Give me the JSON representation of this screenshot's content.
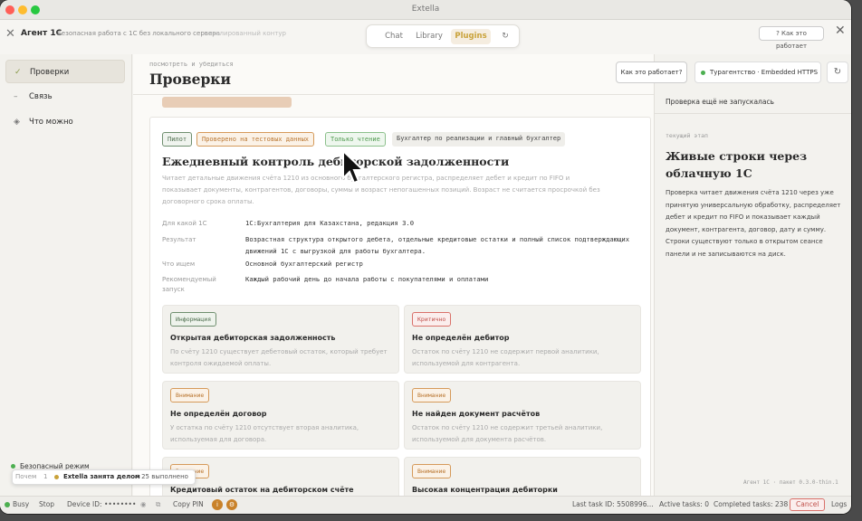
{
  "window": {
    "title": "Extella"
  },
  "header": {
    "brand": "Агент 1С",
    "subtitle": "Безопасная работа с 1С без локального сервера",
    "extra": "изолированный контур",
    "tabs": [
      {
        "label": "Chat"
      },
      {
        "label": "Library"
      },
      {
        "label": "Plugins",
        "active": true
      }
    ],
    "how_button": "? Как это работает"
  },
  "sidebar": {
    "items": [
      {
        "icon": "✓",
        "label": "Проверки",
        "active": true
      },
      {
        "icon": "–",
        "label": "Связь"
      },
      {
        "icon": "◈",
        "label": "Что можно"
      }
    ],
    "safe_mode": "Безопасный режим",
    "toast": {
      "prefix": "Почем",
      "num": "1",
      "busy": "Extella занята делом",
      "done": "✓ 25 выполнено"
    }
  },
  "main": {
    "breadcrumb": "посмотреть и убедиться",
    "title": "Проверки",
    "card": {
      "tags": [
        "Пилот",
        "Проверено на тестовых данных",
        "Только чтение",
        "Бухгалтер по реализации и главный бухгалтер"
      ],
      "title": "Ежедневный контроль дебиторской задолженности",
      "description": "Читает детальные движения счёта 1210 из основного бухгалтерского регистра, распределяет дебет и кредит по FIFO и показывает документы, контрагентов, договоры, суммы и возраст непогашенных позиций. Возраст не считается просрочкой без договорного срока оплаты.",
      "rows": [
        {
          "key": "Для какой 1С",
          "value": "1С:Бухгалтерия для Казахстана, редакция 3.0"
        },
        {
          "key": "Результат",
          "value": "Возрастная структура открытого дебета, отдельные кредитовые остатки и полный список подтверждающих движений 1С с выгрузкой для работы бухгалтера."
        },
        {
          "key": "Что ищем",
          "value": "Основной бухгалтерский регистр"
        },
        {
          "key": "Рекомендуемый запуск",
          "value": "Каждый рабочий день до начала работы с покупателями и оплатами"
        }
      ],
      "issues": [
        {
          "badge": "Информация",
          "level": "info",
          "title": "Открытая дебиторская задолженность",
          "desc": "По счёту 1210 существует дебетовый остаток, который требует контроля ожидаемой оплаты."
        },
        {
          "badge": "Критично",
          "level": "crit",
          "title": "Не определён дебитор",
          "desc": "Остаток по счёту 1210 не содержит первой аналитики, используемой для контрагента."
        },
        {
          "badge": "Внимание",
          "level": "warn",
          "title": "Не определён договор",
          "desc": "У остатка по счёту 1210 отсутствует вторая аналитика, используемая для договора."
        },
        {
          "badge": "Внимание",
          "level": "warn",
          "title": "Не найден документ расчётов",
          "desc": "Остаток по счёту 1210 не содержит третьей аналитики, используемой для документа расчётов."
        },
        {
          "badge": "Внимание",
          "level": "warn",
          "title": "Кредитовый остаток на дебиторском счёте",
          "desc": ""
        },
        {
          "badge": "Внимание",
          "level": "warn",
          "title": "Высокая концентрация дебиторки",
          "desc": ""
        }
      ]
    }
  },
  "right_panel": {
    "how_button": "Как это работает?",
    "connection": "Турагентство · Embedded HTTPS",
    "status": "Проверка ещё не запускалась",
    "stage_label": "текущий этап",
    "stage_title": "Живые строки через облачную 1С",
    "stage_desc": "Проверка читает движения счёта 1210 через уже принятую универсальную обработку, распределяет дебет и кредит по FIFO и показывает каждый документ, контрагента, договор, дату и сумму. Строки существуют только в открытом сеансе панели и не записываются на диск.",
    "version": "Агент 1С · пакет 0.3.0-thin.1"
  },
  "statusbar": {
    "busy": "Busy",
    "stop": "Stop",
    "device_label": "Device ID:",
    "device_value": "••••••••",
    "copy_pin": "Copy PIN",
    "last_task": "Last task ID: 5508996...",
    "active": "Active tasks: 0",
    "completed": "Completed tasks: 238",
    "cancel": "Cancel",
    "logs": "Logs"
  },
  "colors": {
    "accent": "#c9a23a",
    "info": "#4f6f4f",
    "critical": "#c0504a",
    "warning": "#b9752f",
    "ok": "#4caf50"
  }
}
